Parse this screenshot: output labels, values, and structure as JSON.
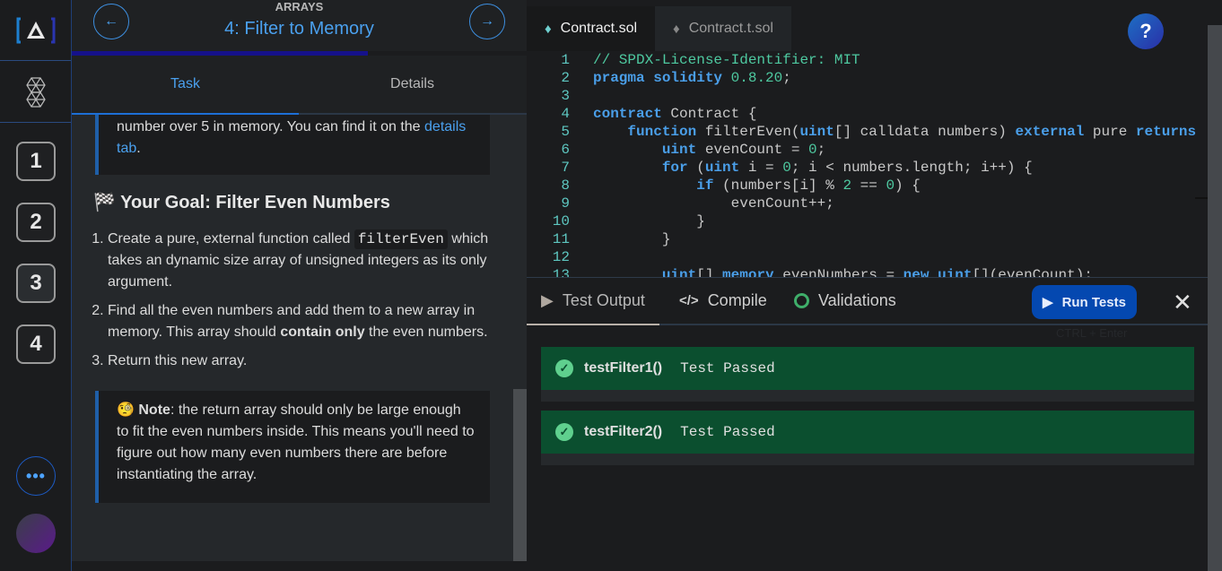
{
  "sidebar": {
    "levels": [
      "1",
      "2",
      "3",
      "4"
    ],
    "more_label": "•••"
  },
  "lesson": {
    "section": "ARRAYS",
    "title": "4: Filter to Memory",
    "progress_percent": 65,
    "tabs": {
      "task": "Task",
      "details": "Details"
    },
    "intro_text": "number over 5 in memory. You can find it on the ",
    "intro_link": "details tab",
    "intro_end": ".",
    "goal_icon": "🏁",
    "goal_heading": "Your Goal: Filter Even Numbers",
    "steps": [
      {
        "a": "Create a pure, external function called ",
        "code": "filterEven",
        "b": " which takes an dynamic size array of unsigned integers as its only argument."
      },
      {
        "a": "Find all the even numbers and add them to a new array in memory. This array should ",
        "bold": "contain only",
        "b": " the even numbers."
      },
      {
        "a": "Return this new array."
      }
    ],
    "note_icon": "🧐",
    "note_label": "Note",
    "note_text": ": the return array should only be large enough to fit the even numbers inside. This means you'll need to figure out how many even numbers there are before instantiating the array."
  },
  "editor": {
    "tabs": [
      "Contract.sol",
      "Contract.t.sol"
    ],
    "help_label": "?",
    "lines": [
      "// SPDX-License-Identifier: MIT",
      "pragma solidity 0.8.20;",
      "",
      "contract Contract {",
      "    function filterEven(uint[] calldata numbers) external pure returns",
      "        uint evenCount = 0;",
      "        for (uint i = 0; i < numbers.length; i++) {",
      "            if (numbers[i] % 2 == 0) {",
      "                evenCount++;",
      "            }",
      "        }",
      "",
      "        uint[] memory evenNumbers = new uint[](evenCount);"
    ]
  },
  "output": {
    "tabs": [
      "Test Output",
      "Compile",
      "Validations"
    ],
    "run_label": "Run Tests",
    "run_hint": "CTRL + Enter",
    "results": [
      {
        "name": "testFilter1()",
        "status": "Test Passed"
      },
      {
        "name": "testFilter2()",
        "status": "Test Passed"
      }
    ]
  }
}
